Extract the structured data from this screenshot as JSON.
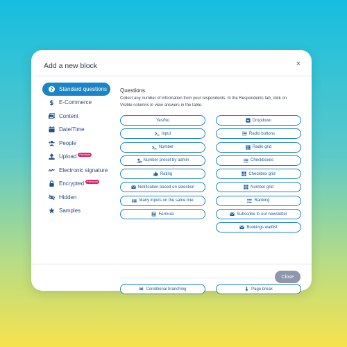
{
  "modal": {
    "title": "Add a new block",
    "close_symbol": "×",
    "close_button": "Close"
  },
  "sidebar": {
    "items": [
      {
        "label": "Standard questions",
        "icon": "question-circle-icon",
        "active": true
      },
      {
        "label": "E-Commerce",
        "icon": "dollar-icon"
      },
      {
        "label": "Content",
        "icon": "images-icon"
      },
      {
        "label": "Date/Time",
        "icon": "calendar-icon"
      },
      {
        "label": "People",
        "icon": "people-icon"
      },
      {
        "label": "Upload",
        "icon": "upload-icon",
        "badge": "Premium"
      },
      {
        "label": "Electronic signature",
        "icon": "signature-icon"
      },
      {
        "label": "Encrypted",
        "icon": "lock-icon",
        "badge": "Premium"
      },
      {
        "label": "Hidden",
        "icon": "eye-slash-icon"
      },
      {
        "label": "Samples",
        "icon": "star-icon"
      }
    ]
  },
  "content": {
    "title": "Questions",
    "description": "Collect any number of information from your respondents. In the Respondents tab, click on Visible columns to view answers in the table.",
    "left_buttons": [
      {
        "label": "Yes/No",
        "icon": ""
      },
      {
        "label": "Input",
        "icon": "terminal-icon"
      },
      {
        "label": "Number",
        "icon": "terminal-icon"
      },
      {
        "label": "Number preset by admin",
        "icon": "user-cog-icon"
      },
      {
        "label": "Rating",
        "icon": "thumbs-up-icon"
      },
      {
        "label": "Notification based on selection",
        "icon": "envelope-icon"
      },
      {
        "label": "Many inputs on the same line",
        "icon": "dots-icon"
      },
      {
        "label": "Formula",
        "icon": "calculator-icon"
      }
    ],
    "right_buttons": [
      {
        "label": "Dropdown",
        "icon": "dropdown-icon"
      },
      {
        "label": "Radio buttons",
        "icon": "list-icon"
      },
      {
        "label": "Radio grid",
        "icon": "grid-icon"
      },
      {
        "label": "Checkboxes",
        "icon": "list-icon"
      },
      {
        "label": "Checkbox grid",
        "icon": "grid-icon"
      },
      {
        "label": "Number grid",
        "icon": "grid-icon"
      },
      {
        "label": "Ranking",
        "icon": "list-icon"
      },
      {
        "label": "Subscribe to our newsletter",
        "icon": "envelope-icon"
      },
      {
        "label": "Bookings waitlist",
        "icon": "envelope-icon"
      }
    ],
    "bottom_buttons": [
      {
        "label": "Conditional branching",
        "icon": "branch-icon"
      },
      {
        "label": "Page break",
        "icon": "page-break-icon"
      }
    ]
  },
  "colors": {
    "accent": "#1a84c6",
    "badge": "#d9246e",
    "close_button": "#8d97ad"
  }
}
